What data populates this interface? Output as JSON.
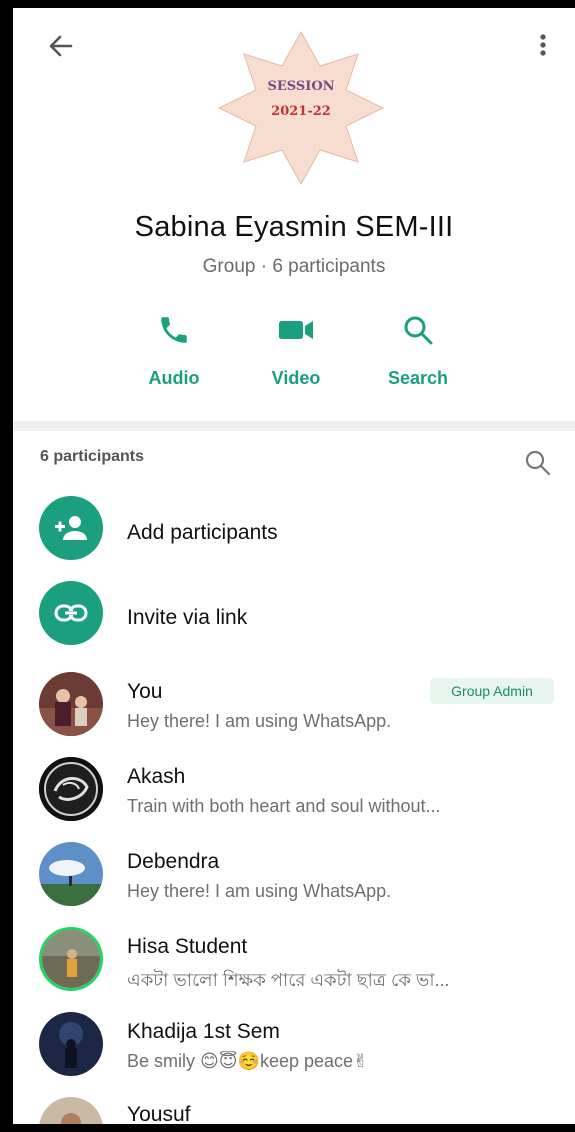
{
  "header": {
    "group_photo": {
      "line1": "SESSION",
      "line2": "2021-22"
    },
    "group_name": "Sabina Eyasmin SEM-III",
    "group_sub": "Group · 6 participants",
    "actions": [
      {
        "label": "Audio",
        "icon": "phone-icon"
      },
      {
        "label": "Video",
        "icon": "video-camera-icon"
      },
      {
        "label": "Search",
        "icon": "search-icon"
      }
    ]
  },
  "participants": {
    "title": "6 participants",
    "add_label": "Add participants",
    "invite_label": "Invite via link",
    "list": [
      {
        "name": "You",
        "status": "Hey there! I am using WhatsApp.",
        "badge": "Group Admin"
      },
      {
        "name": "Akash",
        "status": "Train with both heart and soul without..."
      },
      {
        "name": "Debendra",
        "status": "Hey there! I am using WhatsApp."
      },
      {
        "name": "Hisa Student",
        "status": "একটা ভালো শিক্ষক পারে একটা ছাত্র কে ভা..."
      },
      {
        "name": "Khadija 1st Sem",
        "status": "Be smily 😊😇☺️keep peace✌"
      },
      {
        "name": "Yousuf",
        "status": ""
      }
    ]
  },
  "colors": {
    "accent": "#1aa07e",
    "badge_bg": "#e6f6ef"
  }
}
